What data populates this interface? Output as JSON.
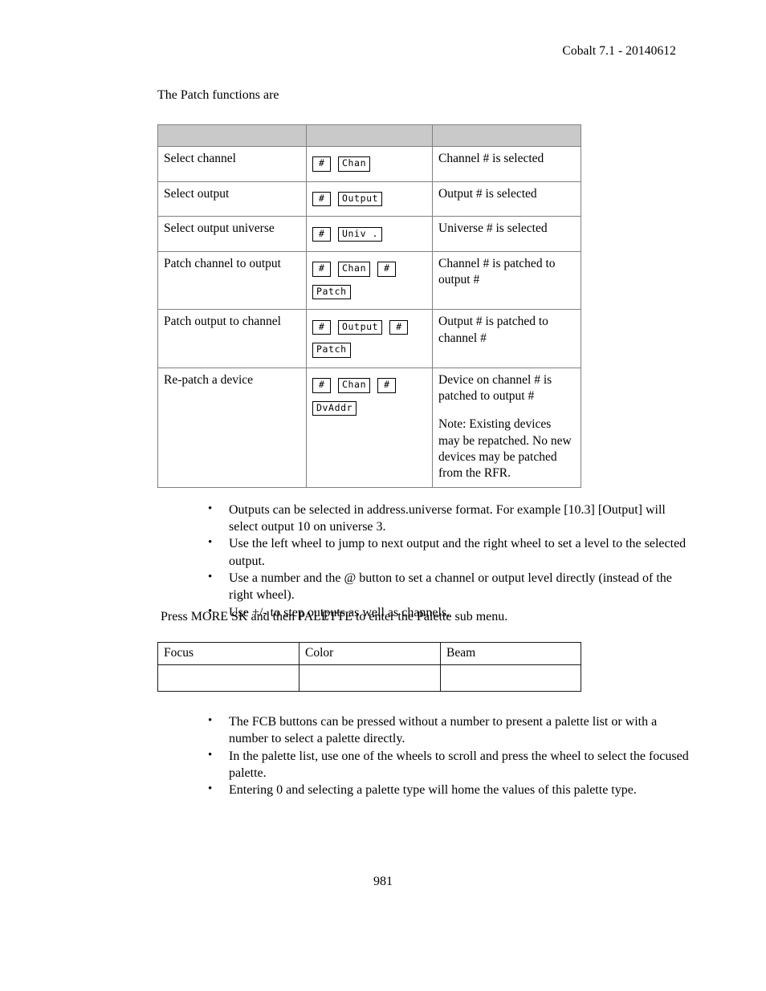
{
  "header": {
    "running_head": "Cobalt 7.1 - 20140612"
  },
  "patch_section": {
    "intro": "The Patch functions are",
    "table": {
      "header_row": [
        "",
        "",
        ""
      ],
      "rows": [
        {
          "function": "Select channel",
          "keys": [
            [
              "#",
              "Chan"
            ]
          ],
          "result": [
            "Channel # is selected"
          ]
        },
        {
          "function": "Select output",
          "keys": [
            [
              "#",
              "Output"
            ]
          ],
          "result": [
            "Output # is selected"
          ]
        },
        {
          "function": "Select output universe",
          "keys": [
            [
              "#",
              "Univ ."
            ]
          ],
          "result": [
            "Universe # is selected"
          ]
        },
        {
          "function": "Patch channel to output",
          "keys": [
            [
              "#",
              "Chan",
              "#"
            ],
            [
              "Patch"
            ]
          ],
          "result": [
            "Channel # is patched to output #"
          ]
        },
        {
          "function": "Patch output to channel",
          "keys": [
            [
              "#",
              "Output",
              "#"
            ],
            [
              "Patch"
            ]
          ],
          "result": [
            "Output # is patched to channel #"
          ]
        },
        {
          "function": "Re-patch a device",
          "keys": [
            [
              "#",
              "Chan",
              "#"
            ],
            [
              "DvAddr"
            ]
          ],
          "result": [
            "Device on channel # is patched to output #",
            "Note: Existing devices may be repatched. No new devices may be patched from the RFR."
          ]
        }
      ]
    },
    "notes": [
      "Outputs can be selected in address.universe format. For example [10.3] [Output] will select output 10 on universe 3.",
      "Use the left wheel to jump to next output and the right wheel to set a level to the selected output.",
      "Use a number and the @ button to set a channel or output level directly (instead of the right wheel).",
      "Use +/- to step outputs as well as channels."
    ]
  },
  "palette_section": {
    "intro": "Press MORE SK and then PALETTE to enter the Palette sub menu.",
    "table": {
      "headers": [
        "Focus",
        "Color",
        "Beam"
      ],
      "rows": [
        [
          "",
          "",
          ""
        ]
      ]
    },
    "notes": [
      "The FCB buttons can be pressed without a number to present a palette list or with a number to select a palette directly.",
      "In the palette list, use one of the wheels to scroll and press the wheel to select the focused palette.",
      "Entering 0 and selecting a palette type will home the values of this palette type."
    ]
  },
  "footer": {
    "page_number": "981"
  }
}
